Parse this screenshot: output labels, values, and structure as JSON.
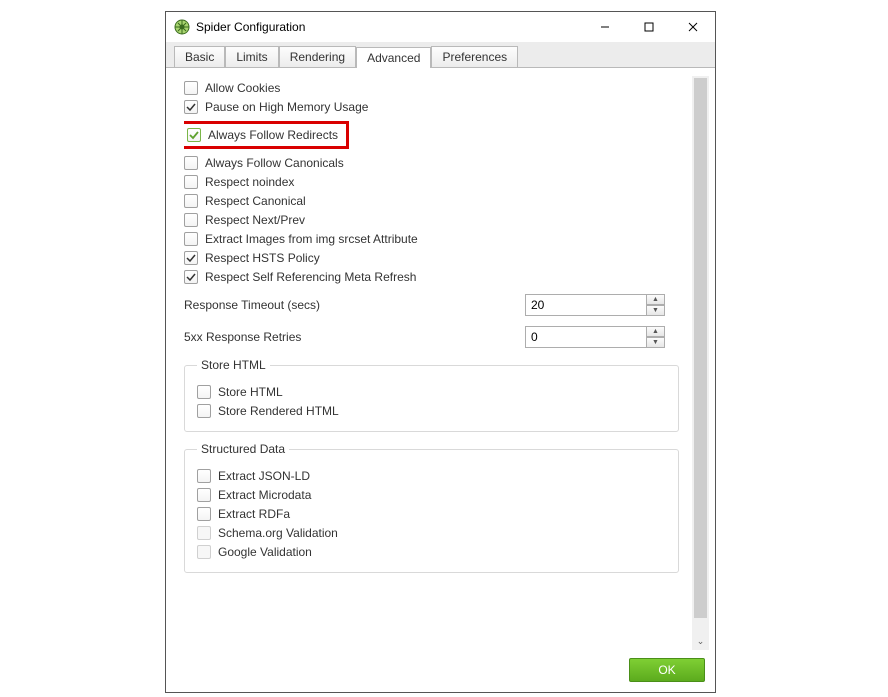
{
  "title": "Spider Configuration",
  "tabs": {
    "basic": "Basic",
    "limits": "Limits",
    "rendering": "Rendering",
    "advanced": "Advanced",
    "preferences": "Preferences"
  },
  "checkboxes": {
    "allow_cookies": {
      "label": "Allow Cookies",
      "checked": false
    },
    "pause_memory": {
      "label": "Pause on High Memory Usage",
      "checked": true
    },
    "always_redirects": {
      "label": "Always Follow Redirects",
      "checked": true
    },
    "always_canonicals": {
      "label": "Always Follow Canonicals",
      "checked": false
    },
    "respect_noindex": {
      "label": "Respect noindex",
      "checked": false
    },
    "respect_canonical": {
      "label": "Respect Canonical",
      "checked": false
    },
    "respect_nextprev": {
      "label": "Respect Next/Prev",
      "checked": false
    },
    "extract_srcset": {
      "label": "Extract Images from img srcset Attribute",
      "checked": false
    },
    "respect_hsts": {
      "label": "Respect HSTS Policy",
      "checked": true
    },
    "respect_selfref": {
      "label": "Respect Self Referencing Meta Refresh",
      "checked": true
    }
  },
  "fields": {
    "response_timeout": {
      "label": "Response Timeout (secs)",
      "value": "20"
    },
    "retries": {
      "label": "5xx Response Retries",
      "value": "0"
    }
  },
  "groups": {
    "store_html": {
      "legend": "Store HTML",
      "items": {
        "store_html": {
          "label": "Store HTML",
          "checked": false
        },
        "store_rendered": {
          "label": "Store Rendered HTML",
          "checked": false
        }
      }
    },
    "structured": {
      "legend": "Structured Data",
      "items": {
        "jsonld": {
          "label": "Extract JSON-LD",
          "checked": false
        },
        "microdata": {
          "label": "Extract Microdata",
          "checked": false
        },
        "rdfa": {
          "label": "Extract RDFa",
          "checked": false
        },
        "schema": {
          "label": "Schema.org Validation",
          "checked": false,
          "disabled": true
        },
        "google": {
          "label": "Google Validation",
          "checked": false,
          "disabled": true
        }
      }
    }
  },
  "footer": {
    "ok": "OK"
  }
}
